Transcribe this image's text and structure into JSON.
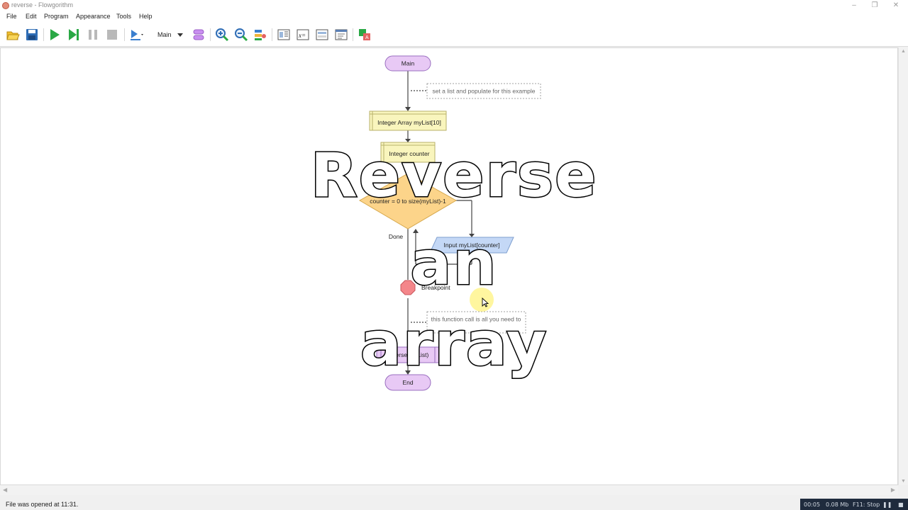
{
  "window": {
    "title": "reverse - Flowgorithm",
    "controls": [
      "minimize",
      "restore",
      "close"
    ]
  },
  "menu": [
    "File",
    "Edit",
    "Program",
    "Appearance",
    "Tools",
    "Help"
  ],
  "toolbar": {
    "function_select": "Main"
  },
  "flowchart": {
    "start_label": "Main",
    "comment1": "set a list and populate for this example",
    "declare1": "Integer Array myList[10]",
    "declare2": "Integer counter",
    "loop_condition": "counter = 0 to size(myList)-1",
    "loop_done_label": "Done",
    "input_label": "Input myList[counter]",
    "breakpoint_label": "Breakpoint",
    "comment2": "this function call is all you need to",
    "call_label": "reverse(myList)",
    "end_label": "End"
  },
  "overlay": {
    "line1": "Reverse",
    "line2": "an",
    "line3": "array"
  },
  "status": {
    "text": "File was opened at 11:31."
  },
  "recorder": {
    "time": "00:05",
    "size": "0.08 Mb",
    "stop": "F11: Stop"
  },
  "colors": {
    "terminal": "#e8c9f5",
    "declare": "#f9f5bd",
    "loop": "#fcd48a",
    "input": "#c4d8f6",
    "breakpoint": "#f4868a",
    "comment_border": "#a0a0a0"
  }
}
